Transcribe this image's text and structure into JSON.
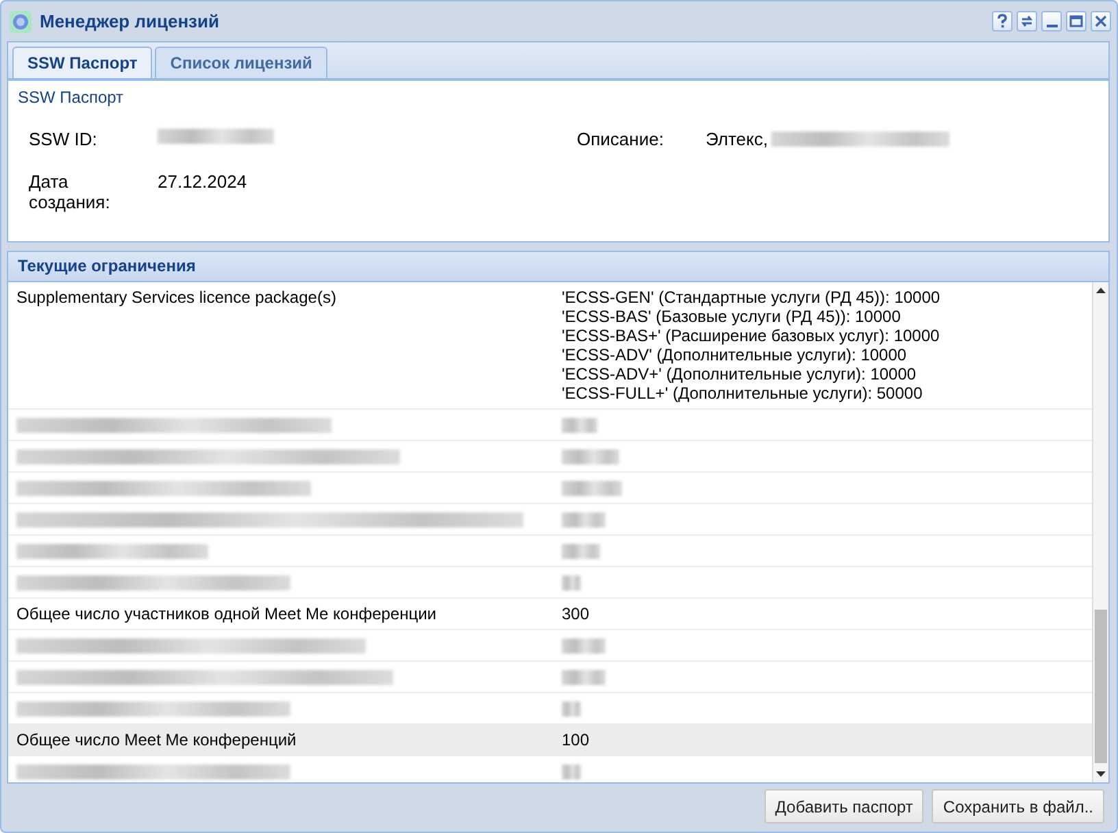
{
  "window": {
    "title": "Менеджер лицензий"
  },
  "tabs": [
    {
      "label": "SSW Паспорт",
      "selected": true
    },
    {
      "label": "Список лицензий",
      "selected": false
    }
  ],
  "passport": {
    "heading": "SSW Паспорт",
    "fields": [
      {
        "label": "SSW ID:",
        "redacted": true
      },
      {
        "label": "Описание:",
        "value": "Элтекс,",
        "redacted": true
      },
      {
        "label": "Дата создания:",
        "value": "27.12.2024"
      }
    ]
  },
  "limits": {
    "title": "Текущие ограничения",
    "rows": [
      {
        "kind": "text",
        "name": "Supplementary Services licence package(s)",
        "value": [
          "'ECSS-GEN' (Стандартные услуги (РД 45)): 10000",
          "'ECSS-BAS' (Базовые услуги (РД 45)): 10000",
          "'ECSS-BAS+' (Расширение базовых услуг): 10000",
          "'ECSS-ADV' (Дополнительные услуги): 10000",
          "'ECSS-ADV+' (Дополнительные услуги): 10000",
          "'ECSS-FULL+' (Дополнительные услуги): 50000"
        ],
        "selected": false
      },
      {
        "kind": "redacted",
        "selected": false
      },
      {
        "kind": "redacted",
        "selected": false
      },
      {
        "kind": "redacted",
        "selected": false
      },
      {
        "kind": "redacted",
        "selected": false
      },
      {
        "kind": "redacted",
        "selected": false
      },
      {
        "kind": "redacted",
        "selected": false
      },
      {
        "kind": "text",
        "name": "Общее число участников одной Meet Me конференции",
        "value": [
          "300"
        ],
        "selected": false
      },
      {
        "kind": "redacted",
        "selected": false
      },
      {
        "kind": "redacted",
        "selected": false
      },
      {
        "kind": "redacted",
        "selected": false
      },
      {
        "kind": "text",
        "name": "Общее число Meet Me конференций",
        "value": [
          "100"
        ],
        "selected": true
      },
      {
        "kind": "redacted",
        "selected": false
      }
    ]
  },
  "buttons": [
    "Добавить паспорт",
    "Сохранить в файл.."
  ]
}
